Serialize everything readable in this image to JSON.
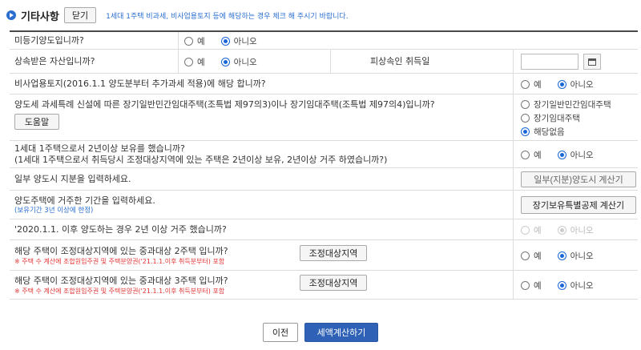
{
  "header": {
    "title": "기타사항",
    "close_label": "닫기",
    "note": "1세대 1주택 비과세, 비사업용토지 등에 해당하는 경우 체크 해 주시기 바랍니다."
  },
  "rows": {
    "unregistered": {
      "question": "미등기양도입니까?",
      "yes": "예",
      "no": "아니오",
      "selected": "no"
    },
    "inherited": {
      "question": "상속받은 자산입니까?",
      "yes": "예",
      "no": "아니오",
      "selected": "no",
      "acq_date_label": "피상속인 취득일",
      "acq_date_value": ""
    },
    "non_business_land": {
      "question": "비사업용토지(2016.1.1 양도분부터 추가과세 적용)에 해당 합니까?",
      "yes": "예",
      "no": "아니오",
      "selected": "no"
    },
    "rental_housing": {
      "question": "양도세 과세특례 신설에 따른 장기일반민간임대주택(조특법 제97의3)이나 장기임대주택(조특법 제97의4)입니까?",
      "help_label": "도움말",
      "options": [
        "장기일반민간임대주택",
        "장기임대주택",
        "해당없음"
      ],
      "selected_index": 2
    },
    "one_house": {
      "question": "1세대 1주택으로서 2년이상 보유를 했습니까?",
      "question_sub": "(1세대 1주택으로서 취득당시 조정대상지역에 있는 주택은 2년이상 보유, 2년이상 거주 하였습니까?)",
      "yes": "예",
      "no": "아니오",
      "selected": "no"
    },
    "partial_share": {
      "question": "일부 양도시 지분을 입력하세요.",
      "button_label": "일부(지분)양도시 계산기"
    },
    "residence_period": {
      "question": "양도주택에 거주한 기간을 입력하세요.",
      "note": "(보유기간 3년 이상에 한정)",
      "button_label": "장기보유특별공제 계산기"
    },
    "since_2020": {
      "question": "'2020.1.1. 이후 양도하는 경우 2년 이상 거주 했습니까?",
      "yes": "예",
      "no": "아니오",
      "selected": "no",
      "disabled": true
    },
    "heavy_two": {
      "question": "해당 주택이 조정대상지역에 있는 중과대상 2주택 입니까?",
      "warning": "※ 주택 수 계산에 조합원입주권 및 주택분양권('21.1.1.이후 취득분부터) 포함",
      "button_label": "조정대상지역",
      "yes": "예",
      "no": "아니오",
      "selected": "no"
    },
    "heavy_three": {
      "question": "해당 주택이 조정대상지역에 있는 중과대상 3주택 입니까?",
      "warning": "※ 주택 수 계산에 조합원입주권 및 주택분양권('21.1.1.이후 취득분부터) 포함",
      "button_label": "조정대상지역",
      "yes": "예",
      "no": "아니오",
      "selected": "no"
    }
  },
  "actions": {
    "prev_label": "이전",
    "calc_label": "세액계산하기"
  },
  "colors": {
    "accent": "#2a6fd0",
    "primary_button": "#2f62b6",
    "warning": "#e03030"
  }
}
